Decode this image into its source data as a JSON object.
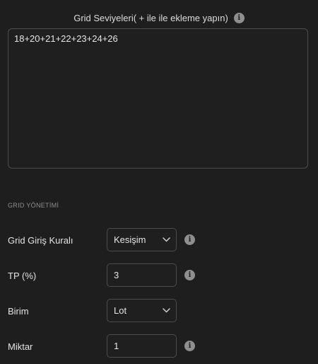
{
  "grid_levels": {
    "title": "Grid Seviyeleri( + ile ile ekleme yapın)",
    "value": "18+20+21+22+23+24+26",
    "info_icon": "info-icon"
  },
  "section": {
    "title": "GRID YÖNETİMİ"
  },
  "rows": [
    {
      "label": "Grid Giriş Kuralı",
      "value": "Kesişim",
      "control": "select",
      "has_info": true
    },
    {
      "label": "TP (%)",
      "value": "3",
      "control": "input",
      "has_info": true
    },
    {
      "label": "Birim",
      "value": "Lot",
      "control": "select",
      "has_info": false
    },
    {
      "label": "Miktar",
      "value": "1",
      "control": "input",
      "has_info": true
    }
  ],
  "colors": {
    "background": "#1e1e1e",
    "border": "#4c4c4c",
    "text": "#e6e6e6",
    "muted": "#8e8e8e"
  }
}
